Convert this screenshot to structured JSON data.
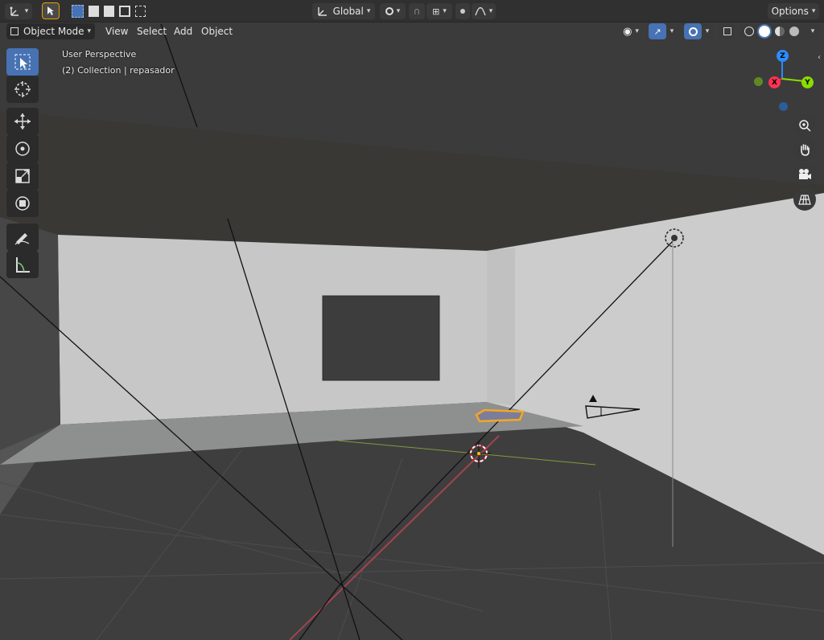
{
  "header": {
    "transform_orientation": "Global",
    "options_label": "Options"
  },
  "toolbar": {
    "mode_label": "Object Mode",
    "menus": [
      "View",
      "Select",
      "Add",
      "Object"
    ]
  },
  "viewport": {
    "perspective_label": "User Perspective",
    "collection_label": "(2) Collection | repasador"
  },
  "gizmo": {
    "axes": [
      {
        "name": "Z",
        "color": "#2b8cff"
      },
      {
        "name": "X",
        "color": "#ff3352"
      },
      {
        "name": "Y",
        "color": "#8bdc00"
      }
    ]
  },
  "tools": [
    "select-box-icon",
    "cursor-icon",
    "move-icon",
    "rotate-icon",
    "scale-icon",
    "transform-icon",
    "annotate-icon",
    "measure-icon"
  ],
  "colors": {
    "accent": "#4772b3",
    "selection_outline": "#f5a623",
    "header_bg": "#303030"
  }
}
